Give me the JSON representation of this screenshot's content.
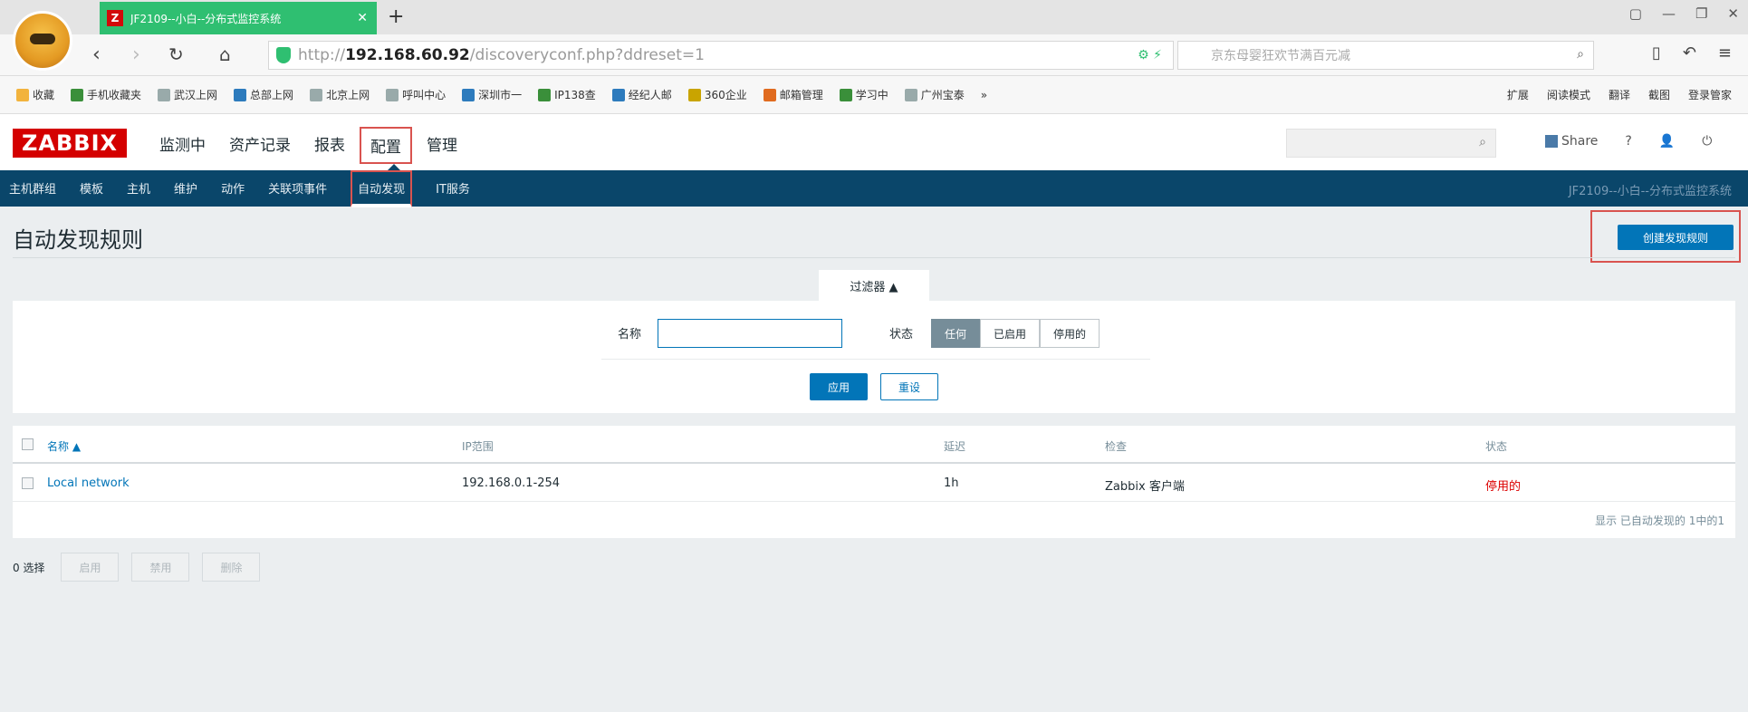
{
  "browser": {
    "tab_title": "JF2109--小白--分布式监控系统",
    "tab_close": "✕",
    "new_tab": "+",
    "url_proto": "http://",
    "url_host": "192.168.60.92",
    "url_path": "/discoveryconf.php?ddreset=1",
    "search_placeholder": "京东母婴狂欢节满百元减",
    "bookmarks": [
      "收藏",
      "手机收藏夹",
      "武汉上网",
      "总部上网",
      "北京上网",
      "呼叫中心",
      "深圳市一",
      "IP138查",
      "经纪人邮",
      "360企业",
      "邮箱管理",
      "学习中",
      "广州宝泰"
    ],
    "bookmarks_more": "»",
    "bookmarks_right": [
      "扩展",
      "阅读模式",
      "翻译",
      "截图",
      "登录管家"
    ]
  },
  "header": {
    "logo": "ZABBIX",
    "menu": [
      "监测中",
      "资产记录",
      "报表",
      "配置",
      "管理"
    ],
    "share": "Share",
    "help": "?",
    "user": "👤",
    "power": "⏻"
  },
  "submenu": {
    "items": [
      "主机群组",
      "模板",
      "主机",
      "维护",
      "动作",
      "关联项事件",
      "自动发现",
      "IT服务"
    ],
    "right": "JF2109--小白--分布式监控系统"
  },
  "page": {
    "title": "自动发现规则",
    "create_button": "创建发现规则"
  },
  "filter": {
    "tab_label": "过滤器 ▲",
    "name_label": "名称",
    "name_value": "",
    "status_label": "状态",
    "status_options": [
      "任何",
      "已启用",
      "停用的"
    ],
    "apply": "应用",
    "reset": "重设"
  },
  "table": {
    "headers": [
      "名称 ▲",
      "IP范围",
      "延迟",
      "检查",
      "状态"
    ],
    "rows": [
      {
        "name": "Local network",
        "ip_range": "192.168.0.1-254",
        "delay": "1h",
        "checks": "Zabbix 客户端",
        "status": "停用的"
      }
    ],
    "footer": "显示 已自动发现的 1中的1"
  },
  "mass": {
    "selected": "0 选择",
    "buttons": [
      "启用",
      "禁用",
      "删除"
    ]
  }
}
